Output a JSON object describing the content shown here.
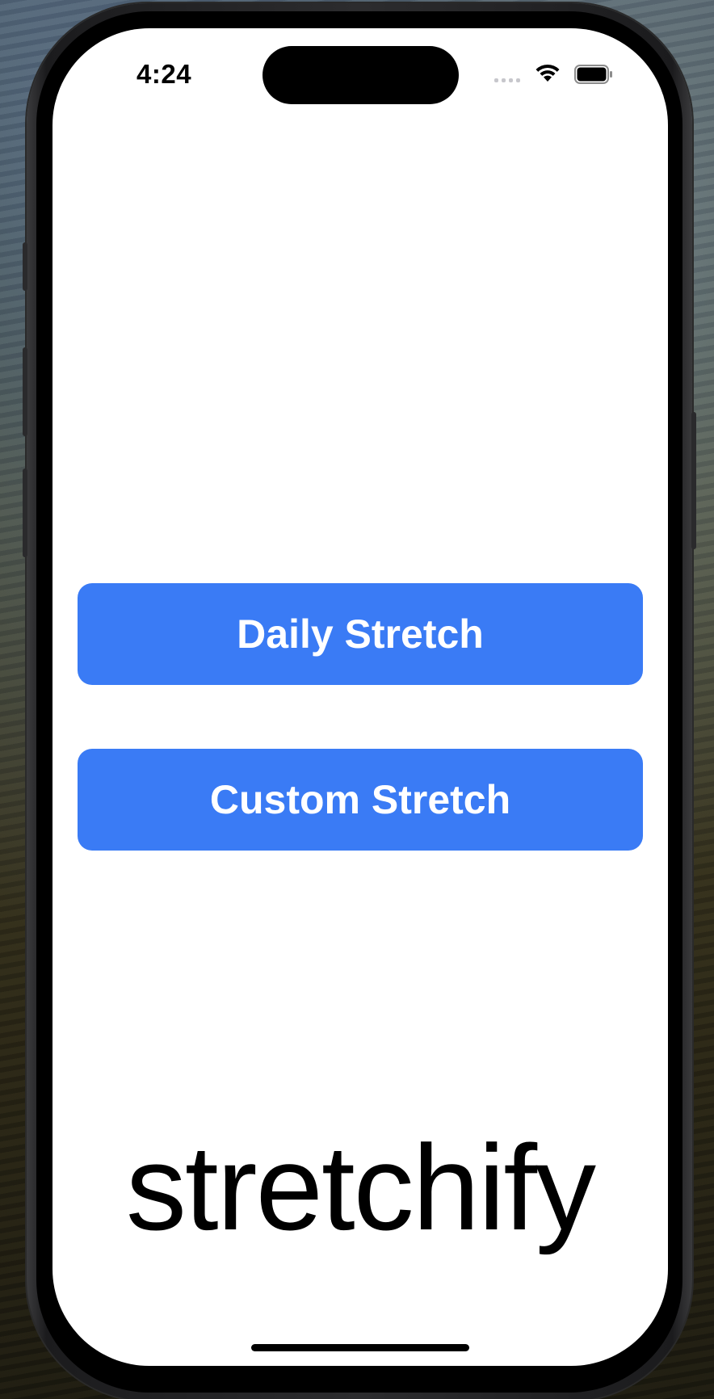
{
  "status_bar": {
    "time": "4:24"
  },
  "buttons": {
    "daily_label": "Daily Stretch",
    "custom_label": "Custom Stretch"
  },
  "brand": {
    "name": "stretchify"
  },
  "colors": {
    "accent": "#3a7bf5",
    "button_text": "#ffffff",
    "background": "#ffffff",
    "brand_text": "#000000"
  },
  "icons": [
    "cellular-signal-icon",
    "wifi-icon",
    "battery-icon"
  ]
}
